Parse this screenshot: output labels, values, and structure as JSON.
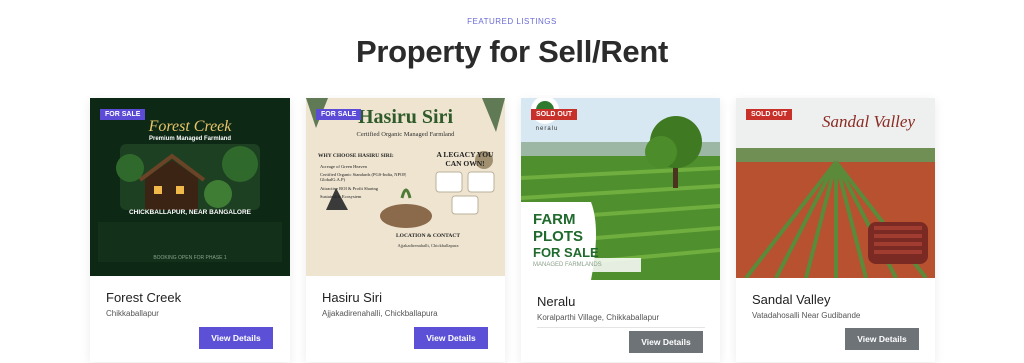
{
  "section": {
    "eyebrow": "FEATURED LISTINGS",
    "title": "Property for Sell/Rent"
  },
  "cards": [
    {
      "badge": "FOR SALE",
      "name": "Forest Creek",
      "location": "Chikkaballapur",
      "button": "View Details",
      "image": {
        "heading": "Forest Creek",
        "subheading": "Premium Managed Farmland",
        "caption": "CHICKBALLAPUR, NEAR BANGALORE",
        "footer": "BOOKING OPEN FOR PHASE 1"
      }
    },
    {
      "badge": "FOR SALE",
      "name": "Hasiru Siri",
      "location": "Ajjakadirenahalli, Chickballapura",
      "button": "View Details",
      "image": {
        "heading": "Hasiru Siri",
        "subheading": "Certified Organic Managed Farmland",
        "why": "WHY CHOOSE HASIRU SIRI:",
        "bullets": [
          "Acreage of Green Heaven",
          "Certified Organic Standards (PGS-India, NPOP, GlobalG.A.P)",
          "Attractive ROI & Profit Sharing",
          "Sustainable Ecosystem"
        ],
        "legacy": "A LEGACY YOU CAN OWN!",
        "contact": "LOCATION & CONTACT",
        "address": "Ajjakadirenahalli, Chickballapura"
      }
    },
    {
      "badge": "SOLD OUT",
      "name": "Neralu",
      "location": "Koralparthi Village, Chikkaballapur",
      "button": "View Details",
      "image": {
        "logo": "neralu",
        "line1": "FARM",
        "line2": "PLOTS",
        "line3": "FOR SALE",
        "strip": "MANAGED FARMLANDS"
      }
    },
    {
      "badge": "SOLD OUT",
      "name": "Sandal Valley",
      "location": "Vatadahosalli Near Gudibande",
      "button": "View Details",
      "image": {
        "script": "Sandal Valley"
      }
    }
  ]
}
